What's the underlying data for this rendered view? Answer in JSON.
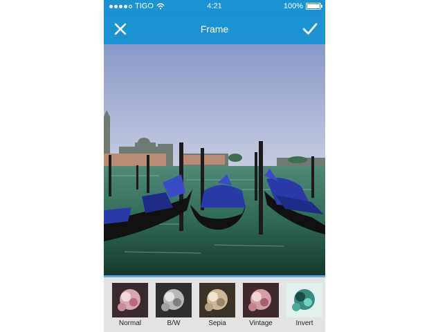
{
  "status_bar": {
    "carrier": "TIGO",
    "time": "4:21",
    "battery": "100%",
    "signal_bars": 4
  },
  "nav": {
    "title": "Frame",
    "close_icon": "close-icon",
    "done_icon": "checkmark-icon"
  },
  "colors": {
    "header": "#1b92d2",
    "tab_border": "#5fa8d8",
    "tab_bg": "#e3e3e3"
  },
  "filters": [
    {
      "label": "Normal"
    },
    {
      "label": "B/W"
    },
    {
      "label": "Sepia"
    },
    {
      "label": "Vintage"
    },
    {
      "label": "Invert"
    }
  ]
}
